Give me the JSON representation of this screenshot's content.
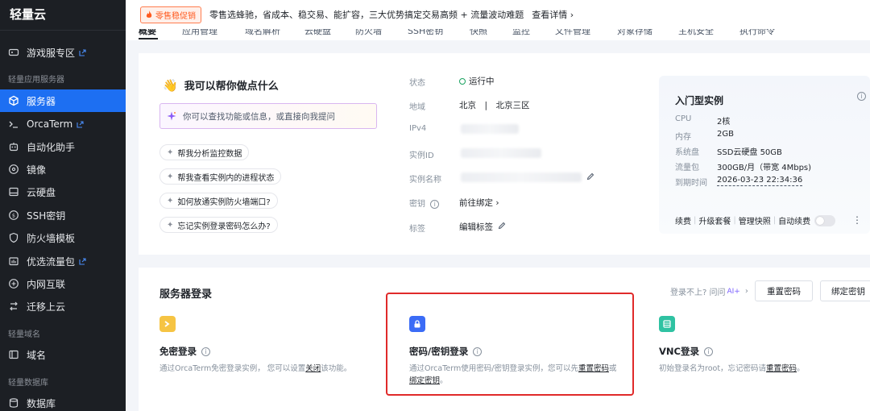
{
  "sidebar": {
    "logo": "轻量云",
    "game_zone": "游戏服专区",
    "section_servers": "轻量应用服务器",
    "items": [
      {
        "label": "服务器"
      },
      {
        "label": "OrcaTerm"
      },
      {
        "label": "自动化助手"
      },
      {
        "label": "镜像"
      },
      {
        "label": "云硬盘"
      },
      {
        "label": "SSH密钥"
      },
      {
        "label": "防火墙模板"
      },
      {
        "label": "优选流量包"
      },
      {
        "label": "内网互联"
      },
      {
        "label": "迁移上云"
      }
    ],
    "section_domain": "轻量域名",
    "domain": "域名",
    "section_db": "轻量数据库",
    "database": "数据库"
  },
  "banner": {
    "tag": "零售稳促销",
    "text": "零售选蜂驰，省成本、稳交易、能扩容，三大优势搞定交易高频 + 流量波动难题",
    "link": "查看详情 ›"
  },
  "tabs": [
    "概要",
    "应用管理",
    "域名解析",
    "云硬盘",
    "防火墙",
    "SSH密钥",
    "快照",
    "监控",
    "文件管理",
    "对象存储",
    "主机安全",
    "执行命令"
  ],
  "assistant": {
    "title": "我可以帮你做点什么",
    "placeholder": "你可以查找功能或信息，或直接向我提问",
    "chips": [
      "帮我分析监控数据",
      "帮我查看实例内的进程状态",
      "如何放通实例防火墙端口?",
      "忘记实例登录密码怎么办?"
    ]
  },
  "instance": {
    "status_label": "状态",
    "status_value": "运行中",
    "region_label": "地域",
    "region_value": "北京　|　北京三区",
    "ipv4_label": "IPv4",
    "id_label": "实例ID",
    "name_label": "实例名称",
    "key_label": "密钥",
    "key_value": "前往绑定 ›",
    "tag_label": "标签",
    "tag_value": "编辑标签"
  },
  "spec": {
    "title": "入门型实例",
    "rows": [
      {
        "label": "CPU",
        "value": "2核"
      },
      {
        "label": "内存",
        "value": "2GB"
      },
      {
        "label": "系统盘",
        "value": "SSD云硬盘 50GB"
      },
      {
        "label": "流量包",
        "value": "300GB/月（带宽 4Mbps)"
      },
      {
        "label": "到期时间",
        "value": "2026-03-23 22:34:36"
      }
    ],
    "actions": [
      "续费",
      "升级套餐",
      "管理快照",
      "自动续费"
    ],
    "more": "⋮"
  },
  "login": {
    "title": "服务器登录",
    "hint": "登录不上? 问问",
    "hint_ai": "AI+",
    "reset_button": "重置密码",
    "bind_button": "绑定密钥",
    "methods": [
      {
        "name": "免密登录",
        "desc_a": "通过OrcaTerm免密登录实例，  您可以设置",
        "link_a": "关闭",
        "desc_b": "该功能。"
      },
      {
        "name": "密码/密钥登录",
        "desc_a": "通过OrcaTerm使用密码/密钥登录实例，您可以先",
        "link_a": "重置密码",
        "desc_b": "或",
        "link_b": "绑定密钥",
        "desc_c": "。"
      },
      {
        "name": "VNC登录",
        "desc_a": "初始登录名为root，忘记密码请",
        "link_a": "重置密码",
        "desc_b": "。"
      }
    ]
  },
  "colors": {
    "accent": "#1d6ff2",
    "highlight": "#e02a2a",
    "sidebar_bg": "#1c1f24",
    "running": "#1aa260"
  }
}
